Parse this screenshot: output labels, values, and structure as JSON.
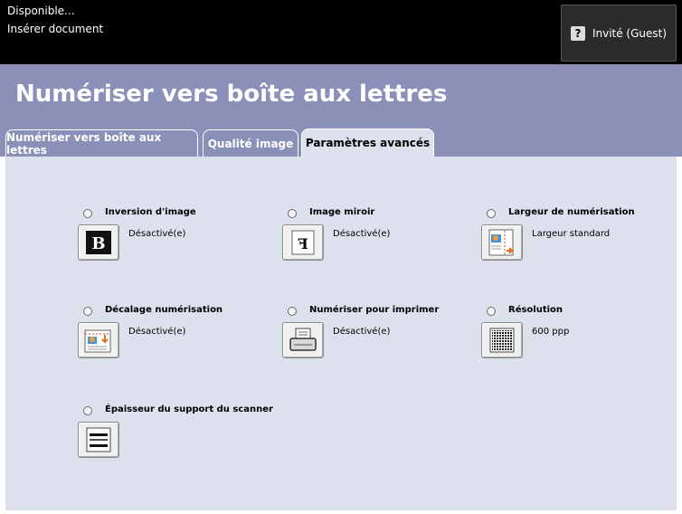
{
  "status": {
    "line1": "Disponible...",
    "line2": "Insérer document"
  },
  "user_button": {
    "icon": "question-icon",
    "label": "Invité (Guest)"
  },
  "page_title": "Numériser vers boîte aux lettres",
  "tabs": [
    {
      "label": "Numériser vers boîte aux lettres",
      "active": false
    },
    {
      "label": "Qualité image",
      "active": false
    },
    {
      "label": "Paramètres avancés",
      "active": true
    }
  ],
  "features": [
    {
      "label": "Inversion d'image",
      "value": "Désactivé(e)",
      "icon": "image-inversion-icon"
    },
    {
      "label": "Image miroir",
      "value": "Désactivé(e)",
      "icon": "mirror-image-icon"
    },
    {
      "label": "Largeur de numérisation",
      "value": "Largeur standard",
      "icon": "scan-width-icon"
    },
    {
      "label": "Décalage numérisation",
      "value": "Désactivé(e)",
      "icon": "scan-shift-icon"
    },
    {
      "label": "Numériser pour imprimer",
      "value": "Désactivé(e)",
      "icon": "scan-to-print-icon"
    },
    {
      "label": "Résolution",
      "value": "600 ppp",
      "icon": "resolution-icon"
    },
    {
      "label": "Épaisseur du support du scanner",
      "value": "",
      "icon": "scanner-thickness-icon"
    }
  ]
}
